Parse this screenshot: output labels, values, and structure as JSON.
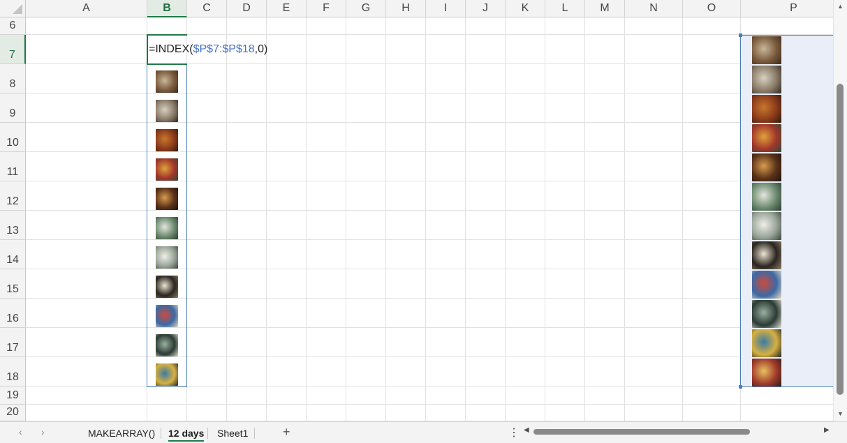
{
  "columns": [
    "A",
    "B",
    "C",
    "D",
    "E",
    "F",
    "G",
    "H",
    "I",
    "J",
    "K",
    "L",
    "M",
    "N",
    "O",
    "P"
  ],
  "selected_column": "B",
  "rows": [
    "6",
    "7",
    "8",
    "9",
    "10",
    "11",
    "12",
    "13",
    "14",
    "15",
    "16",
    "17",
    "18",
    "19",
    "20"
  ],
  "selected_row": "7",
  "active_cell": {
    "formula_prefix": "=INDEX(",
    "formula_ref": "$P$7:$P$18",
    "formula_suffix": ",0)"
  },
  "images": [
    {
      "name": "partridge",
      "colors": [
        "#c9b79a",
        "#7a5a3c",
        "#3d2a1d"
      ]
    },
    {
      "name": "turtle-doves",
      "colors": [
        "#d8d0bf",
        "#8a7b68",
        "#2e2a26"
      ]
    },
    {
      "name": "french-hens",
      "colors": [
        "#c8772e",
        "#8b3a1a",
        "#2b1c12"
      ]
    },
    {
      "name": "calling-birds",
      "colors": [
        "#e0a23a",
        "#a0362a",
        "#2e4a3a"
      ]
    },
    {
      "name": "golden-rings",
      "colors": [
        "#d89a4e",
        "#5a3218",
        "#1d1410"
      ]
    },
    {
      "name": "geese-laying",
      "colors": [
        "#e4e6df",
        "#6b8a6e",
        "#2d3b34"
      ]
    },
    {
      "name": "swans-swimming",
      "colors": [
        "#f0efe8",
        "#9aa59a",
        "#3c4640"
      ]
    },
    {
      "name": "maids-milking",
      "colors": [
        "#ece4d0",
        "#2a2520",
        "#8a7c62"
      ]
    },
    {
      "name": "ladies-dancing",
      "colors": [
        "#d04a3a",
        "#3a6aa6",
        "#e8d8c0"
      ]
    },
    {
      "name": "lords-leaping",
      "colors": [
        "#9ab0a0",
        "#2a3a34",
        "#e0ddd0"
      ]
    },
    {
      "name": "pipers-piping",
      "colors": [
        "#3a7aa6",
        "#d8b040",
        "#1e2a30"
      ]
    },
    {
      "name": "drummers-drumming",
      "colors": [
        "#e8c060",
        "#a03a2a",
        "#2a1e1a"
      ]
    }
  ],
  "sheet_tabs": [
    {
      "label": "MAKEARRAY()",
      "active": false
    },
    {
      "label": "12 days",
      "active": true
    },
    {
      "label": "Sheet1",
      "active": false
    }
  ],
  "icons": {
    "prev": "‹",
    "next": "›",
    "add": "+",
    "more": "⋮",
    "left": "◀",
    "right": "▶",
    "up": "▲",
    "down": "▼"
  }
}
